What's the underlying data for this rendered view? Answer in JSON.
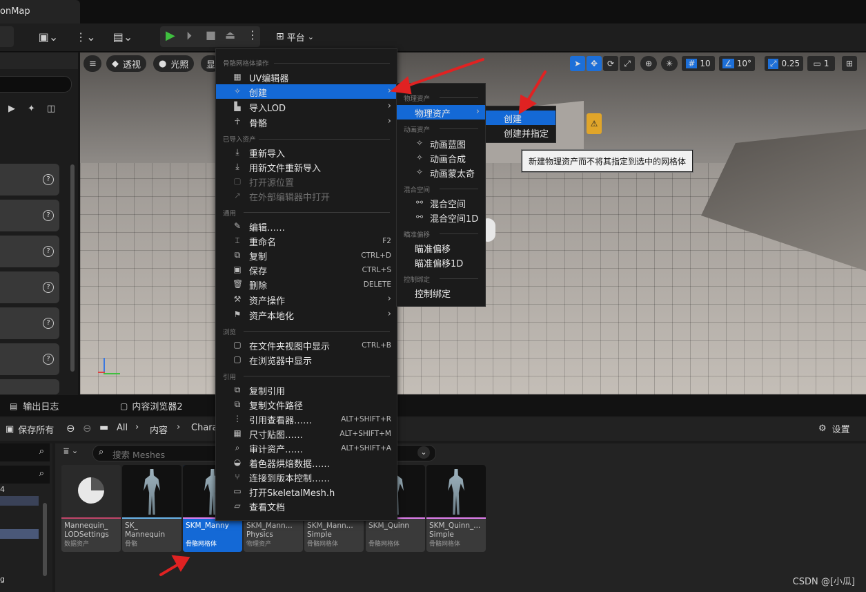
{
  "window": {
    "map_tab": "onMap"
  },
  "toolbar": {
    "platform_label": "平台"
  },
  "viewport": {
    "perspective_label": "透视",
    "lighting_label": "光照",
    "show_label": "显",
    "grid_snap_value": "10",
    "rotation_snap_value": "10°",
    "scale_snap_value": "0.25",
    "camera_speed_value": "1"
  },
  "context_menu": {
    "section_mesh_ops": "骨骼网格体操作",
    "uv_editor": "UV编辑器",
    "create": "创建",
    "import_lod": "导入LOD",
    "skeleton": "骨骼",
    "section_imported": "已导入资产",
    "reimport": "重新导入",
    "reimport_new_file": "用新文件重新导入",
    "open_source_location": "打开源位置",
    "open_external_editor": "在外部编辑器中打开",
    "section_common": "通用",
    "edit": "编辑……",
    "rename": "重命名",
    "rename_shortcut": "F2",
    "duplicate": "复制",
    "duplicate_shortcut": "CTRL+D",
    "save": "保存",
    "save_shortcut": "CTRL+S",
    "delete": "删除",
    "delete_shortcut": "DELETE",
    "asset_actions": "资产操作",
    "asset_localization": "资产本地化",
    "section_browse": "浏览",
    "show_in_folder": "在文件夹视图中显示",
    "show_in_folder_shortcut": "CTRL+B",
    "show_in_explorer": "在浏览器中显示",
    "section_reference": "引用",
    "copy_reference": "复制引用",
    "copy_file_path": "复制文件路径",
    "reference_viewer": "引用查看器……",
    "reference_viewer_shortcut": "ALT+SHIFT+R",
    "size_map": "尺寸贴图……",
    "size_map_shortcut": "ALT+SHIFT+M",
    "audit_assets": "审计资产……",
    "audit_assets_shortcut": "ALT+SHIFT+A",
    "shader_cook_data": "着色器烘焙数据……",
    "connect_source_control": "连接到版本控制……",
    "open_header": "打开SkeletalMesh.h",
    "view_docs": "查看文档"
  },
  "create_submenu": {
    "section_physics": "物理资产",
    "physics_asset": "物理资产",
    "section_animation": "动画资产",
    "anim_blueprint": "动画蓝图",
    "anim_composite": "动画合成",
    "anim_montage": "动画蒙太奇",
    "section_blendspace": "混合空间",
    "blend_space": "混合空间",
    "blend_space_1d": "混合空间1D",
    "section_aim_offset": "瞄准偏移",
    "aim_offset": "瞄准偏移",
    "aim_offset_1d": "瞄准偏移1D",
    "section_control_rig": "控制绑定",
    "control_rig": "控制绑定"
  },
  "physics_submenu": {
    "create": "创建",
    "create_and_assign": "创建并指定"
  },
  "tooltip": "新建物理资产而不将其指定到选中的网格体",
  "bottom": {
    "output_log_tab": "输出日志",
    "content_browser_tab": "内容浏览器2",
    "save_all": "保存所有",
    "breadcrumb": [
      "All",
      "内容",
      "Chara"
    ],
    "settings": "设置",
    "search_placeholder": "搜索 Meshes",
    "side_label_1": "4",
    "side_label_2": "g"
  },
  "assets": [
    {
      "name": "Mannequin_\nLODSettings",
      "type": "数据资产",
      "color": "#c2456a"
    },
    {
      "name": "SK_\nMannequin",
      "type": "骨骼",
      "color": "#6ab4ea"
    },
    {
      "name": "SKM_Manny",
      "type": "骨骼网格体",
      "color": "#e27ff0"
    },
    {
      "name": "SKM_Mann...\nPhysics",
      "type": "物理资产",
      "color": "#7b7b7b"
    },
    {
      "name": "SKM_Mann...\nSimple",
      "type": "骨骼网格体",
      "color": "#e27ff0"
    },
    {
      "name": "SKM_Quinn",
      "type": "骨骼网格体",
      "color": "#e27ff0"
    },
    {
      "name": "SKM_Quinn_...\nSimple",
      "type": "骨骼网格体",
      "color": "#e27ff0"
    }
  ],
  "watermark": "CSDN @[小瓜]"
}
